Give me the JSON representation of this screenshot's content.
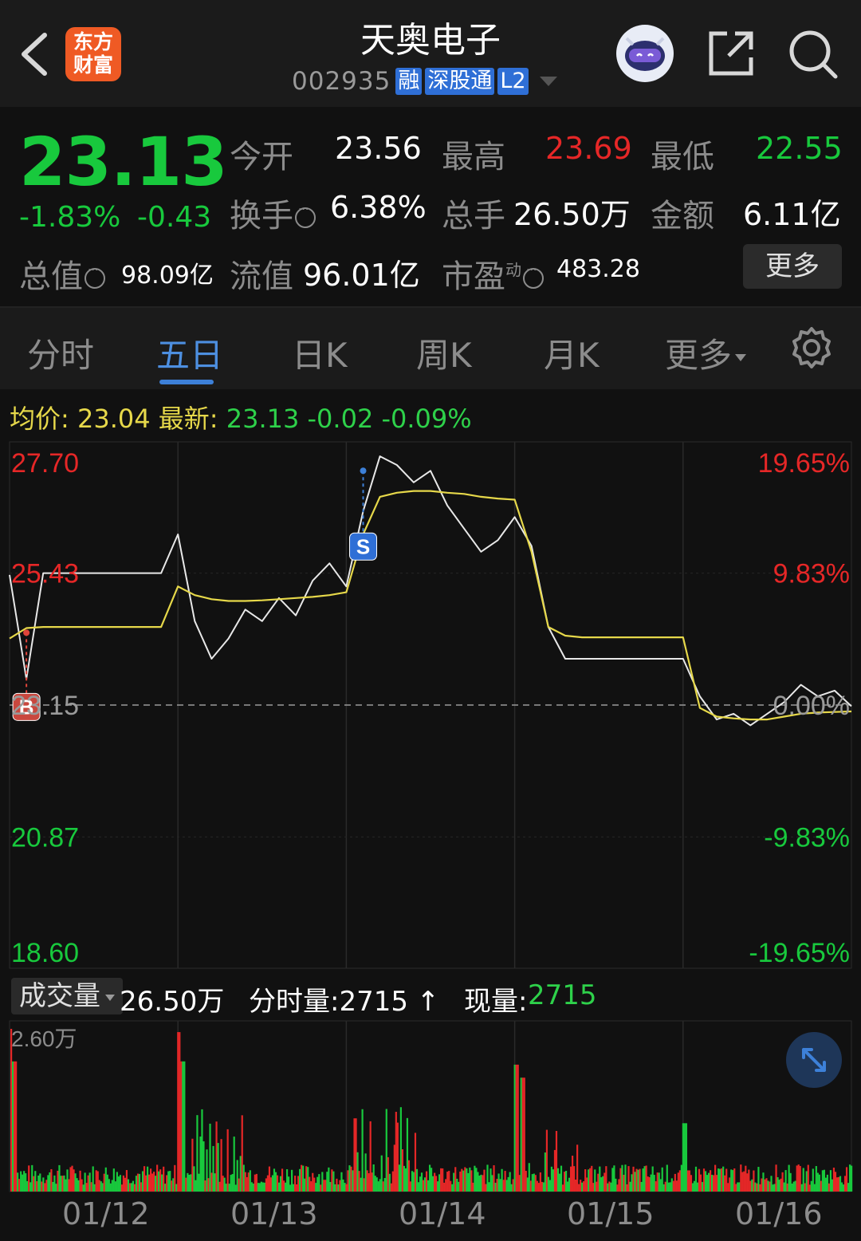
{
  "header": {
    "logo_line1": "东方",
    "logo_line2": "财富",
    "stock_name": "天奥电子",
    "stock_code": "002935",
    "tags": [
      "融",
      "深股通",
      "L2"
    ]
  },
  "quote": {
    "price": "23.13",
    "change_pct": "-1.83%",
    "change_abs": "-0.43",
    "open_label": "今开",
    "open_value": "23.56",
    "high_label": "最高",
    "high_value": "23.69",
    "low_label": "最低",
    "low_value": "22.55",
    "turnover_label": "换手",
    "turnover_value": "6.38%",
    "volume_label": "总手",
    "volume_value": "26.50万",
    "amount_label": "金额",
    "amount_value": "6.11亿",
    "mktcap_label": "总值",
    "mktcap_value": "98.09亿",
    "float_label": "流值",
    "float_value": "96.01亿",
    "pe_label": "市盈",
    "pe_sup": "动",
    "pe_value": "483.28",
    "more_label": "更多"
  },
  "tabs": {
    "items": [
      "分时",
      "五日",
      "日K",
      "周K",
      "月K",
      "更多"
    ],
    "active": "五日"
  },
  "chart_header": {
    "avg_label": "均价:",
    "avg_value": "23.04",
    "latest_label": "最新:",
    "latest_value": "23.13",
    "latest_chg": "-0.02",
    "latest_pct": "-0.09%"
  },
  "colors": {
    "up": "#e62727",
    "down": "#18c93d",
    "avg_line": "#e6d84a",
    "accent": "#3d80d8"
  },
  "chart_data": {
    "type": "line",
    "title": "",
    "xlabel": "",
    "ylabel": "",
    "x": [
      "01/12",
      "01/13",
      "01/14",
      "01/15",
      "01/16"
    ],
    "ylim": [
      18.6,
      27.7
    ],
    "y_ticks_left": [
      "27.70",
      "25.43",
      "23.15",
      "20.87",
      "18.60"
    ],
    "y_ticks_right": [
      "19.65%",
      "9.83%",
      "0.00%",
      "-9.83%",
      "-19.65%"
    ],
    "reference_price": 23.15,
    "grid": true,
    "markers": [
      {
        "label": "B",
        "day": "01/12",
        "price": 24.4
      },
      {
        "label": "S",
        "day": "01/14",
        "price": 27.2
      }
    ],
    "series": [
      {
        "name": "最新",
        "values": [
          25.4,
          23.6,
          25.43,
          25.43,
          25.43,
          25.43,
          25.43,
          25.43,
          25.43,
          25.43,
          26.1,
          24.6,
          23.95,
          24.3,
          24.8,
          24.6,
          25.0,
          24.7,
          25.3,
          25.6,
          25.2,
          26.5,
          27.45,
          27.3,
          27.0,
          27.2,
          26.6,
          26.2,
          25.8,
          26.0,
          26.4,
          25.9,
          24.5,
          23.95,
          23.95,
          23.95,
          23.95,
          23.95,
          23.95,
          23.95,
          23.95,
          23.3,
          22.9,
          23.0,
          22.8,
          23.0,
          23.2,
          23.5,
          23.3,
          23.4,
          23.13
        ]
      },
      {
        "name": "均价",
        "values": [
          24.3,
          24.48,
          24.5,
          24.5,
          24.5,
          24.5,
          24.5,
          24.5,
          24.5,
          24.5,
          25.2,
          25.05,
          24.98,
          24.95,
          24.95,
          24.96,
          24.98,
          25.0,
          25.02,
          25.05,
          25.1,
          26.1,
          26.75,
          26.82,
          26.85,
          26.85,
          26.82,
          26.8,
          26.75,
          26.72,
          26.7,
          25.8,
          24.5,
          24.35,
          24.32,
          24.32,
          24.32,
          24.32,
          24.32,
          24.32,
          24.32,
          23.1,
          22.95,
          22.92,
          22.9,
          22.9,
          22.95,
          23.0,
          23.02,
          23.03,
          23.04
        ]
      }
    ],
    "volume": {
      "total_label": "成交量",
      "total_value": "26.50万",
      "minute_label": "分时量:2715",
      "now_label": "现量:",
      "now_value": "2715",
      "max_label": "2.60万",
      "unit": "万手"
    }
  }
}
